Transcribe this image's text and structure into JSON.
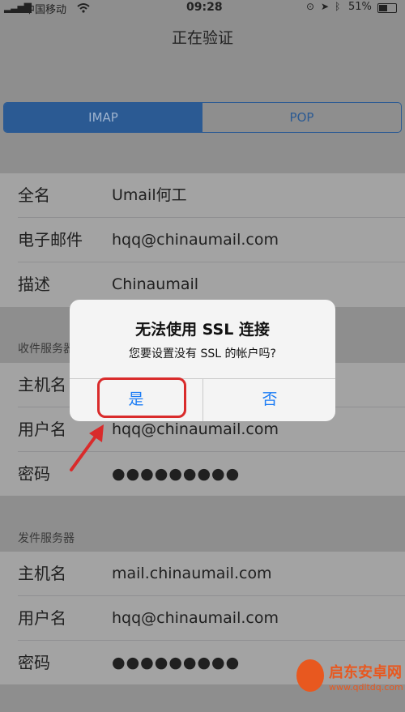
{
  "status": {
    "carrier": "中国移动",
    "time": "09:28",
    "battery": "51%"
  },
  "nav": {
    "title": "正在验证"
  },
  "segment": {
    "imap": "IMAP",
    "pop": "POP"
  },
  "account": [
    {
      "label": "全名",
      "value": "Umail何工"
    },
    {
      "label": "电子邮件",
      "value": "hqq@chinaumail.com"
    },
    {
      "label": "描述",
      "value": "Chinaumail"
    }
  ],
  "incoming": {
    "header": "收件服务器",
    "rows": [
      {
        "label": "主机名",
        "value": ""
      },
      {
        "label": "用户名",
        "value": "hqq@chinaumail.com"
      },
      {
        "label": "密码",
        "value": "●●●●●●●●●"
      }
    ]
  },
  "outgoing": {
    "header": "发件服务器",
    "rows": [
      {
        "label": "主机名",
        "value": "mail.chinaumail.com"
      },
      {
        "label": "用户名",
        "value": "hqq@chinaumail.com"
      },
      {
        "label": "密码",
        "value": "●●●●●●●●●"
      }
    ]
  },
  "alert": {
    "title": "无法使用 SSL 连接",
    "message": "您要设置没有 SSL 的帐户吗?",
    "yes": "是",
    "no": "否"
  },
  "watermark": {
    "text": "启东安卓网",
    "url": "www.qdltdq.com"
  }
}
